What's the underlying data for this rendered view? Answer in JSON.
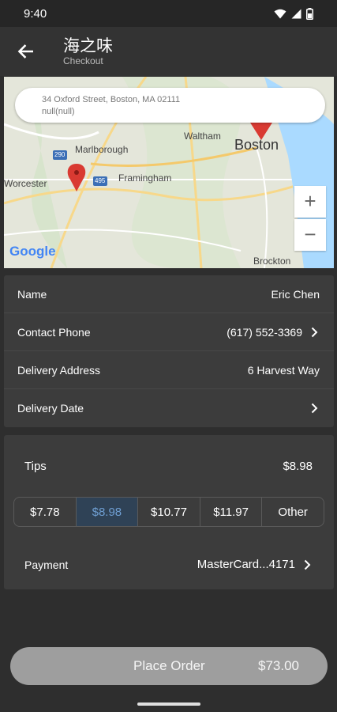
{
  "status_bar": {
    "time": "9:40"
  },
  "header": {
    "title": "海之味",
    "subtitle": "Checkout"
  },
  "map": {
    "address_line1": "34 Oxford Street, Boston, MA 02111",
    "address_line2": "null(null)",
    "labels": {
      "marlborough": "Marlborough",
      "waltham": "Waltham",
      "boston": "Boston",
      "worcester": "Worcester",
      "framingham": "Framingham",
      "brockton": "Brockton",
      "route_290": "290",
      "route_495": "495"
    },
    "zoom_in": "+",
    "zoom_out": "−",
    "logo": "Google"
  },
  "details": {
    "name_label": "Name",
    "name_value": "Eric Chen",
    "phone_label": "Contact Phone",
    "phone_value": "(617) 552-3369",
    "address_label": "Delivery Address",
    "address_value": "6 Harvest Way",
    "date_label": "Delivery Date",
    "date_value": ""
  },
  "tips": {
    "label": "Tips",
    "amount": "$8.98",
    "options": [
      "$7.78",
      "$8.98",
      "$10.77",
      "$11.97",
      "Other"
    ],
    "selected_index": 1
  },
  "payment": {
    "label": "Payment",
    "value": "MasterCard...4171"
  },
  "order": {
    "button_label": "Place Order",
    "total": "$73.00"
  },
  "colors": {
    "background": "#2e2e2e",
    "card": "#3c3c3c",
    "selected_tip_bg": "#2f4256",
    "selected_tip_text": "#6f9fd3",
    "button": "#9e9e9e",
    "map_pin": "#d93a32"
  }
}
